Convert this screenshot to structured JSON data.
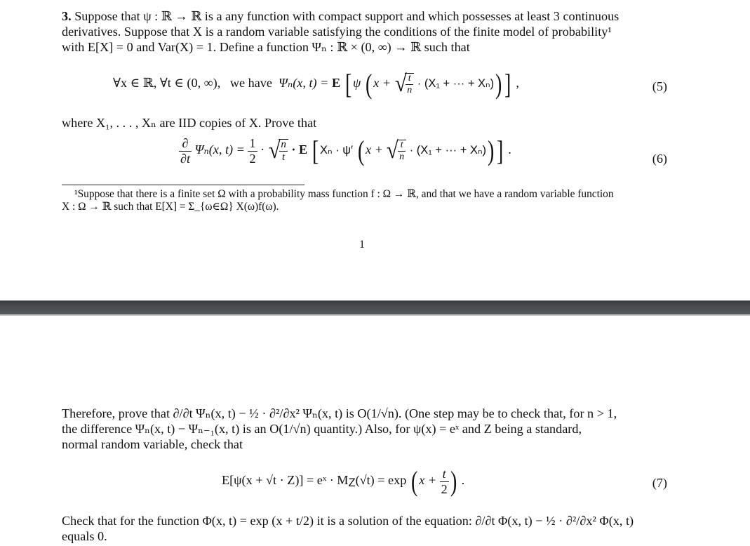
{
  "page1": {
    "problem_number": "3.",
    "intro_lines": [
      "Suppose that ψ : ℝ → ℝ is a any function with compact support and which possesses at least 3 continuous",
      "derivatives. Suppose that X is a random variable satisfying the conditions of the finite model of probability¹",
      "with E[X] = 0 and Var(X) = 1. Define a function Ψₙ : ℝ × (0, ∞) → ℝ such that"
    ],
    "eq5": {
      "quantifiers": "∀x ∈ ℝ,  ∀t ∈ (0, ∞),",
      "we_have": "we have",
      "lhs": "Ψₙ(x, t) =",
      "expect": "E",
      "inner_left": "ψ",
      "x_plus": "x +",
      "sqrt_num": "t",
      "sqrt_den": "n",
      "sum": "· (X₁ + ··· + Xₙ)",
      "trailing": ",",
      "number": "(5)"
    },
    "where_line": "where X₁, . . . , Xₙ are IID copies of X. Prove that",
    "eq6": {
      "deriv_num": "∂",
      "deriv_den": "∂t",
      "lhs": "Ψₙ(x, t) =",
      "half_num": "1",
      "half_den": "2",
      "sqrt_num": "n",
      "sqrt_den": "t",
      "expect": "· E",
      "inner": "Xₙ · ψ′",
      "x_plus": "x +",
      "sqrt2_num": "t",
      "sqrt2_den": "n",
      "sum": "· (X₁ + ··· + Xₙ)",
      "trailing": ".",
      "number": "(6)"
    },
    "footnote_lines": [
      "¹Suppose that there is a finite set Ω with a probability mass function f : Ω → ℝ, and that we have a random variable function",
      "X : Ω → ℝ such that E[X] = Σ_{ω∈Ω} X(ω)f(ω)."
    ],
    "page_number": "1"
  },
  "page2": {
    "therefore_lines": [
      "Therefore, prove that ∂/∂t Ψₙ(x, t) − ½ · ∂²/∂x² Ψₙ(x, t) is O(1/√n). (One step may be to check that, for n > 1,",
      "the difference Ψₙ(x, t) − Ψₙ₋₁(x, t) is an O(1/√n) quantity.) Also, for ψ(x) = eˣ and Z being a standard,",
      "normal random variable, check that"
    ],
    "eq7": {
      "lhs": "E[ψ(x + √t · Z)] = eˣ · M",
      "mgf_sub": "Z",
      "mgf_arg": "(√t) = exp",
      "x_plus": "x +",
      "frac_num": "t",
      "frac_den": "2",
      "trailing": ".",
      "number": "(7)"
    },
    "check_lines": [
      "Check that for the function Φ(x, t) = exp (x + t/2) it is a solution of the equation: ∂/∂t Φ(x, t) − ½ · ∂²/∂x² Φ(x, t)",
      "equals 0."
    ]
  }
}
